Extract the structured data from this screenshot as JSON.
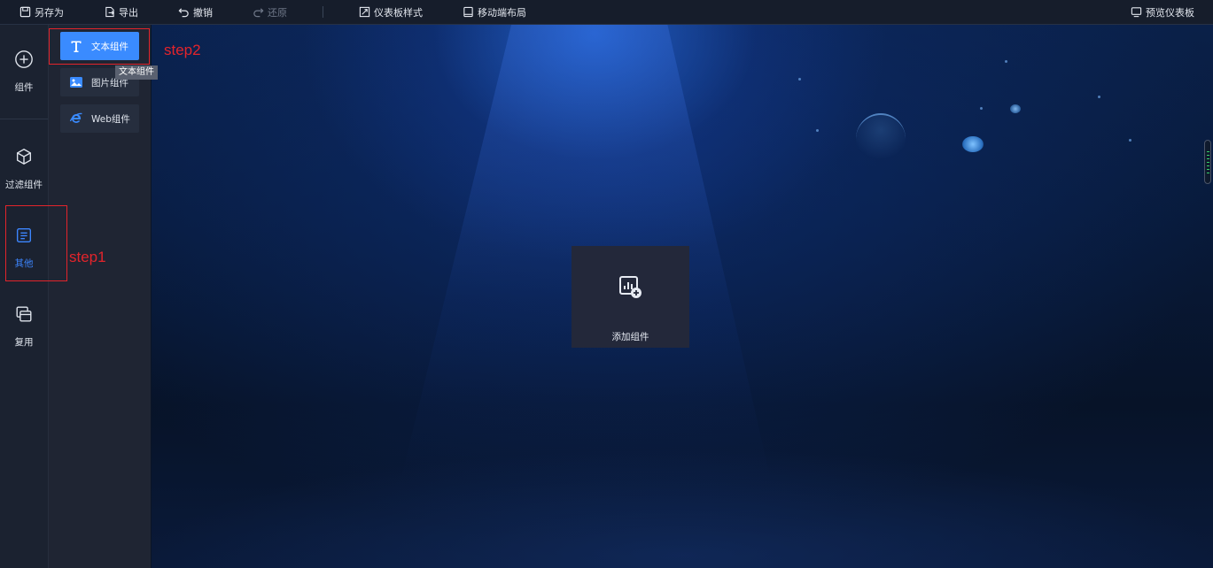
{
  "toolbar": {
    "save_as": "另存为",
    "export": "导出",
    "undo": "撤销",
    "redo": "还原",
    "dashboard_style": "仪表板样式",
    "mobile_layout": "移动端布局",
    "preview": "预览仪表板"
  },
  "rail": {
    "components": "组件",
    "filter_components": "过滤组件",
    "other": "其他",
    "reuse": "复用"
  },
  "panel": {
    "text_component": "文本组件",
    "image_component": "图片组件",
    "web_component": "Web组件",
    "tooltip": "文本组件"
  },
  "canvas": {
    "add_component": "添加组件"
  },
  "annotations": {
    "step1": "step1",
    "step2": "step2"
  },
  "colors": {
    "accent": "#3a8bff",
    "annotation": "#e3242b",
    "toolbar_bg": "#161d2b",
    "panel_bg": "#1f2533"
  }
}
